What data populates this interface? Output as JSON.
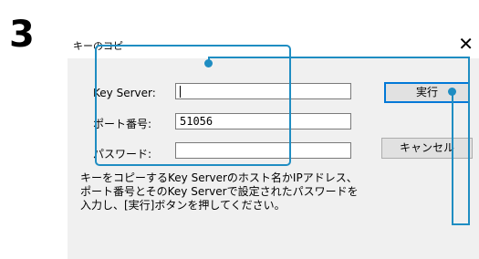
{
  "step_number": "3",
  "dialog": {
    "title": "キーのコピー",
    "close_glyph": "✕",
    "key_server_label": "Key Server:",
    "key_server_value": "",
    "port_label": "ポート番号:",
    "port_value": "51056",
    "password_label": "パスワード:",
    "password_value": "",
    "execute_button": "実行",
    "cancel_button": "キャンセル",
    "description": "キーをコピーするKey Serverのホスト名かIPアドレス、\nポート番号とそのKey Serverで設定されたパスワードを\n入力し、[実行]ボタンを押してください。"
  },
  "colors": {
    "callout": "#1f8dc2",
    "default_button_border": "#0078d7"
  }
}
